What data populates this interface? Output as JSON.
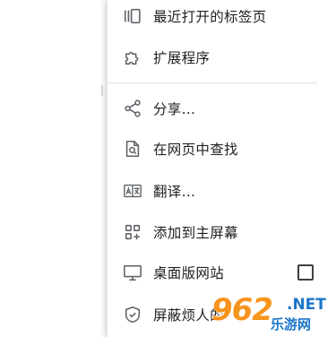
{
  "menu": {
    "items": [
      {
        "label": "最近打开的标签页",
        "icon": "recent-tabs-icon"
      },
      {
        "label": "扩展程序",
        "icon": "puzzle-icon"
      },
      {
        "label": "分享...",
        "icon": "share-icon"
      },
      {
        "label": "在网页中查找",
        "icon": "find-in-page-icon"
      },
      {
        "label": "翻译...",
        "icon": "translate-icon"
      },
      {
        "label": "添加到主屏幕",
        "icon": "add-to-home-icon"
      },
      {
        "label": "桌面版网站",
        "icon": "desktop-icon",
        "checked": false
      },
      {
        "label": "屏蔽烦人的",
        "icon": "shield-icon"
      }
    ]
  },
  "watermark": {
    "number": "962",
    "domain": ".NET",
    "site": "乐游网"
  },
  "colors": {
    "text": "#202124",
    "icon": "#5f6368",
    "watermark_orange": "#f7941d",
    "watermark_blue": "#1a75c9"
  }
}
